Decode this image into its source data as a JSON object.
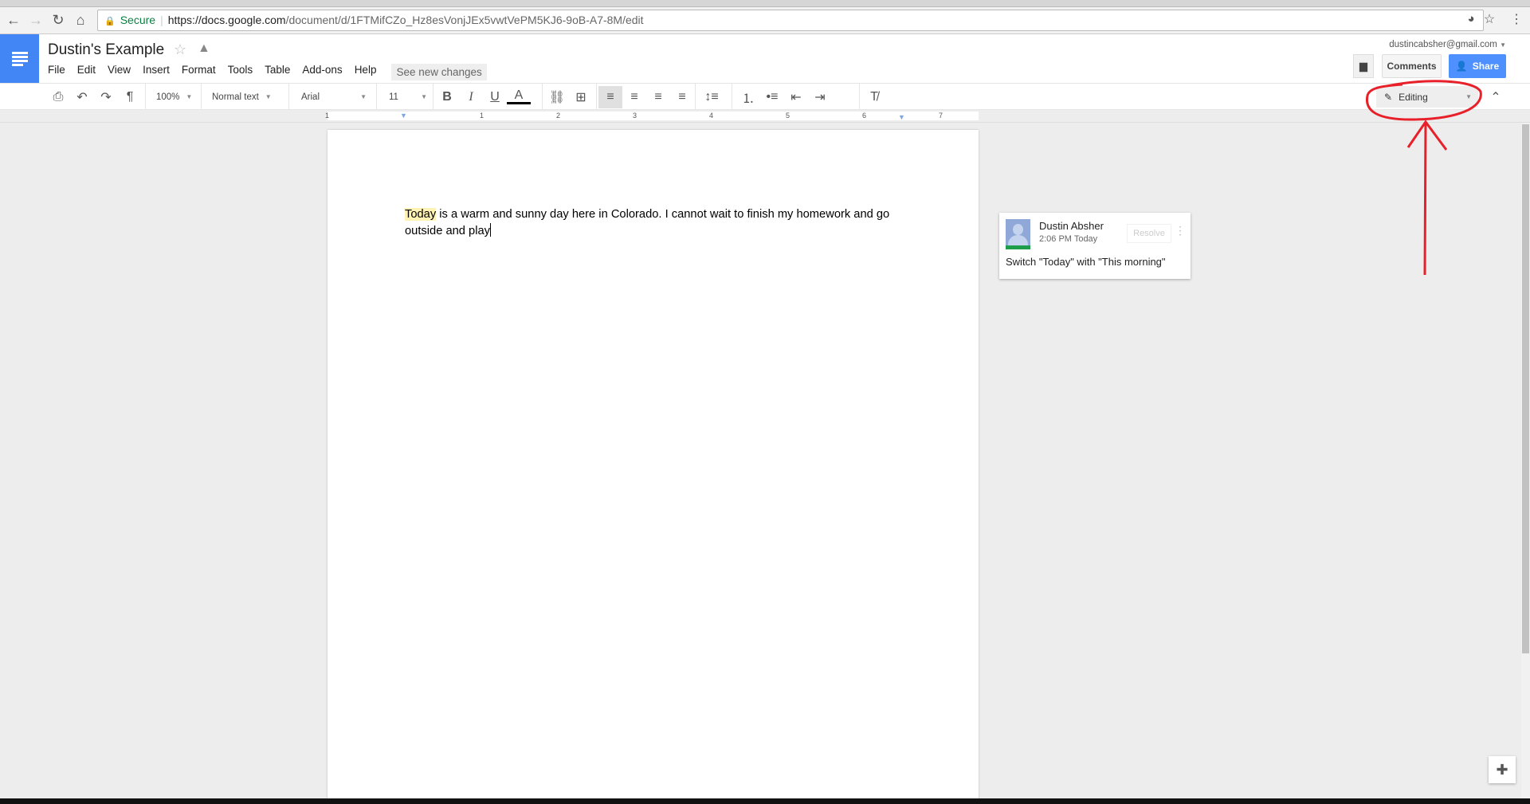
{
  "browser": {
    "secure_label": "Secure",
    "url_host": "https://docs.google.com",
    "url_path": "/document/d/1FTMifCZo_Hz8esVonjJEx5vwtVePM5KJ6-9oB-A7-8M/edit",
    "icons": [
      "back-icon",
      "forward-icon",
      "reload-icon",
      "home-icon",
      "lock-icon",
      "extension-icon",
      "bookmark-star-icon",
      "menu-icon"
    ]
  },
  "header": {
    "title": "Dustin's Example",
    "menus": [
      "File",
      "Edit",
      "View",
      "Insert",
      "Format",
      "Tools",
      "Table",
      "Add-ons",
      "Help"
    ],
    "see_new_changes": "See new changes",
    "account": "dustincabsher@gmail.com",
    "comments_label": "Comments",
    "share_label": "Share",
    "share_color": "#4d90fe"
  },
  "toolbar": {
    "zoom": "100%",
    "style": "Normal text",
    "font": "Arial",
    "size": "11",
    "bold": "B",
    "italic": "I",
    "underline": "U",
    "text_color": "A",
    "mode": "Editing"
  },
  "ruler": {
    "labels": [
      "1",
      "1",
      "2",
      "3",
      "4",
      "5",
      "6",
      "7"
    ]
  },
  "document": {
    "highlighted_word": "Today",
    "text_line1": " is a warm and sunny day here in Colorado.  I cannot wait to finish my homework and go",
    "text_line2": "outside and play",
    "highlight_color": "#fff2b5"
  },
  "comment": {
    "author": "Dustin Absher",
    "time": "2:06 PM Today",
    "resolve_label": "Resolve",
    "body": "Switch \"Today\" with \"This morning\""
  },
  "annotation": {
    "color": "#e8202a",
    "shape": "circle-and-arrow"
  }
}
